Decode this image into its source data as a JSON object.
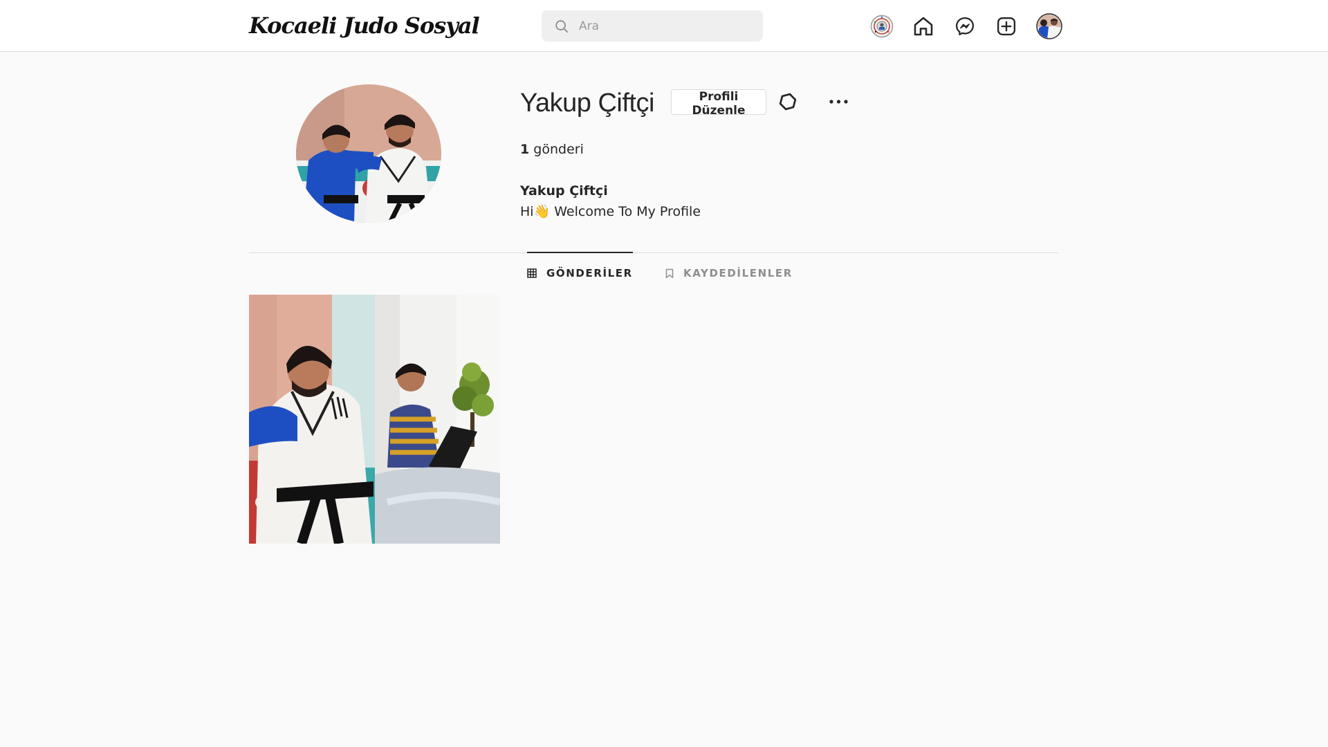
{
  "header": {
    "logo_text": "Kocaeli Judo Sosyal",
    "search_placeholder": "Ara",
    "nav_icons": [
      "judo-federation-icon",
      "home-icon",
      "messenger-icon",
      "add-post-icon",
      "avatar"
    ]
  },
  "profile": {
    "username": "Yakup Çiftçi",
    "edit_button": "Profili Düzenle",
    "post_count": "1",
    "post_count_label": "gönderi",
    "bio_name": "Yakup Çiftçi",
    "bio_text": "Hi👋 Welcome To My Profile"
  },
  "tabs": [
    {
      "label": "GÖNDERİLER",
      "active": true,
      "icon": "grid-icon"
    },
    {
      "label": "KAYDEDİLENLER",
      "active": false,
      "icon": "bookmark-icon"
    }
  ],
  "colors": {
    "background": "#fafafa",
    "topbar": "#ffffff",
    "border": "#dbdbdb",
    "text": "#262626",
    "muted": "#8e8e8e",
    "judo_blue": "#1e4fc2"
  }
}
